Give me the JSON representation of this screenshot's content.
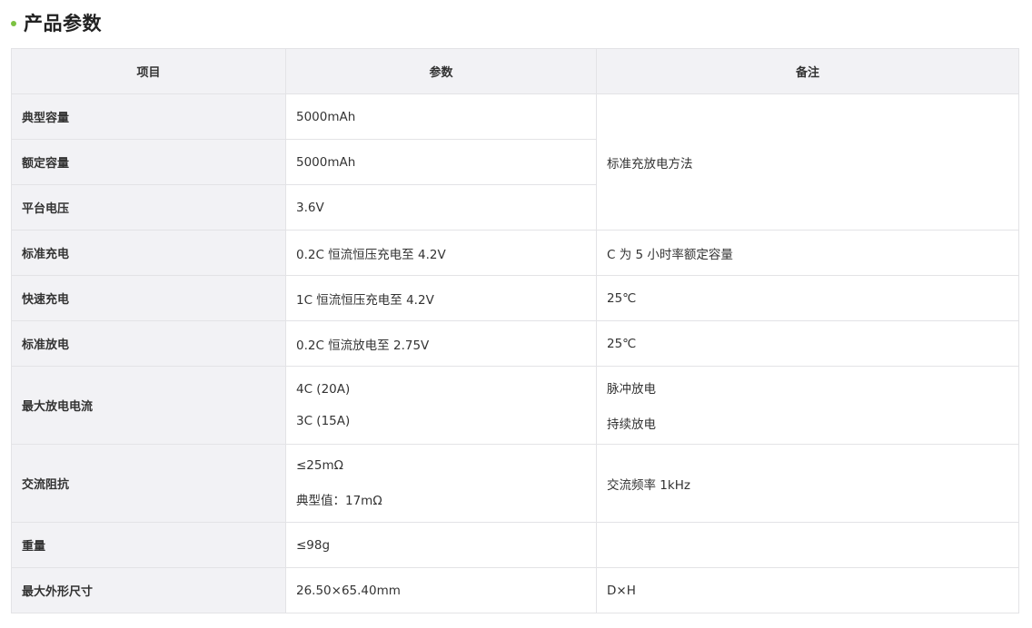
{
  "section": {
    "title": "产品参数",
    "bullet_color": "#7cc242"
  },
  "table": {
    "headers": [
      "项目",
      "参数",
      "备注"
    ],
    "rows": [
      {
        "item": "典型容量",
        "value": [
          "5000mAh"
        ],
        "note": [
          "标准充放电方法"
        ]
      },
      {
        "item": "额定容量",
        "value": [
          "5000mAh"
        ]
      },
      {
        "item": "平台电压",
        "value": [
          "3.6V"
        ]
      },
      {
        "item": "标准充电",
        "value": [
          "0.2C 恒流恒压充电至 4.2V"
        ],
        "note": [
          "C 为 5 小时率额定容量"
        ]
      },
      {
        "item": "快速充电",
        "value": [
          "1C 恒流恒压充电至 4.2V"
        ],
        "note": [
          "25℃"
        ]
      },
      {
        "item": "标准放电",
        "value": [
          "0.2C 恒流放电至 2.75V"
        ],
        "note": [
          "25℃"
        ]
      },
      {
        "item": "最大放电电流",
        "value": [
          "4C (20A)",
          "3C (15A)"
        ],
        "note": [
          "脉冲放电",
          "持续放电"
        ]
      },
      {
        "item": "交流阻抗",
        "value": [
          "≤25mΩ",
          "典型值：17mΩ"
        ],
        "note": [
          "交流频率 1kHz"
        ]
      },
      {
        "item": "重量",
        "value": [
          "≤98g"
        ],
        "note": [
          ""
        ]
      },
      {
        "item": "最大外形尺寸",
        "value": [
          "26.50×65.40mm"
        ],
        "note": [
          "D×H"
        ]
      }
    ]
  }
}
